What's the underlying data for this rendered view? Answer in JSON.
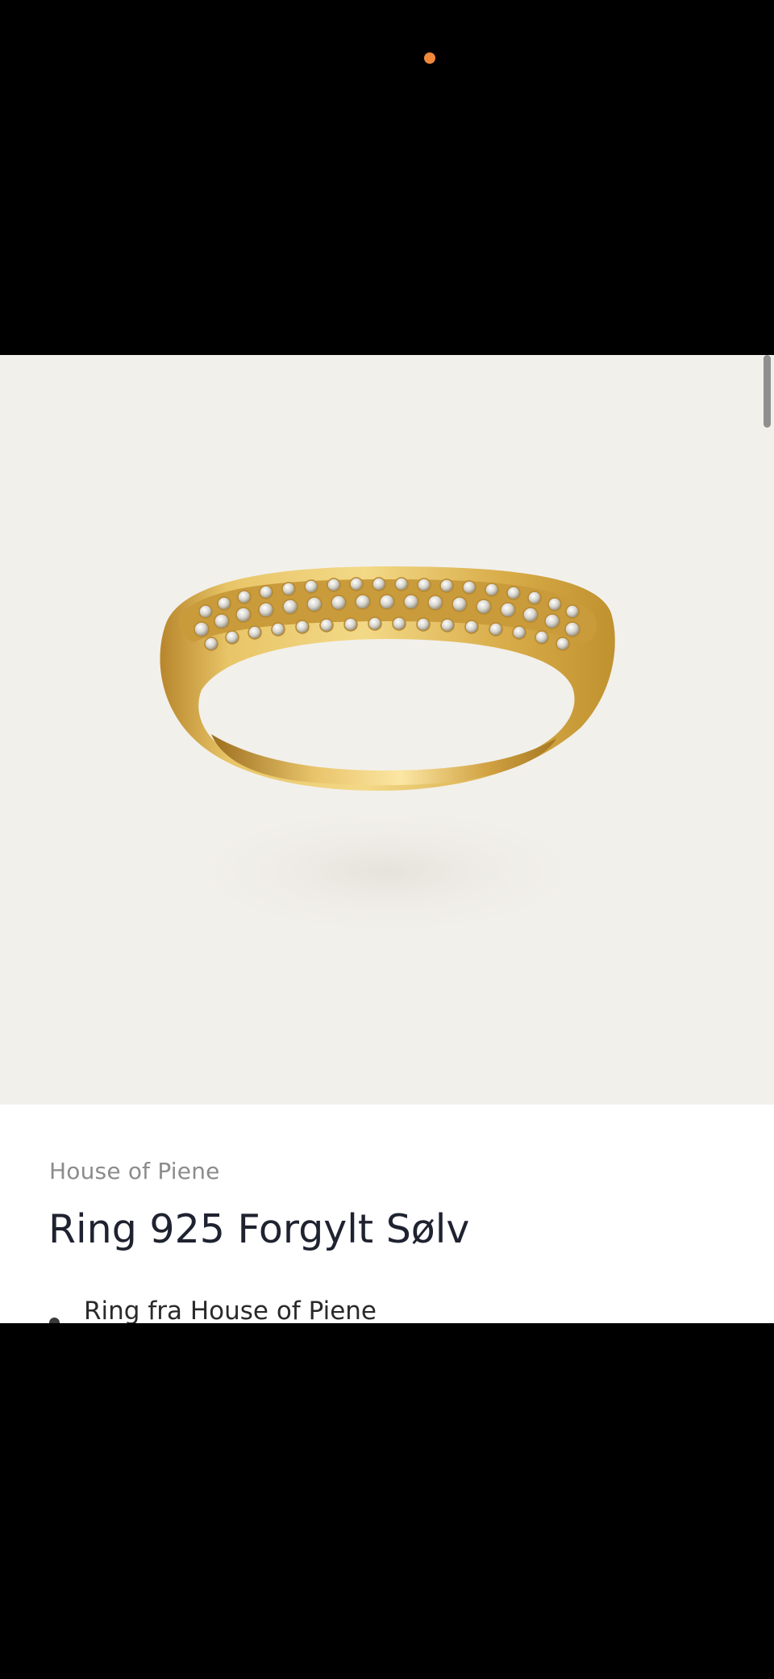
{
  "product": {
    "brand": "House of Piene",
    "title": "Ring 925 Forgylt Sølv",
    "bullets": [
      "Ring fra House of Piene"
    ],
    "image_icon": "gold-pave-ring-image"
  },
  "colors": {
    "image_background": "#f2f0eb",
    "camera_indicator": "#f0883a",
    "brand_text": "#8c8c8c",
    "title_text": "#1f2330"
  }
}
